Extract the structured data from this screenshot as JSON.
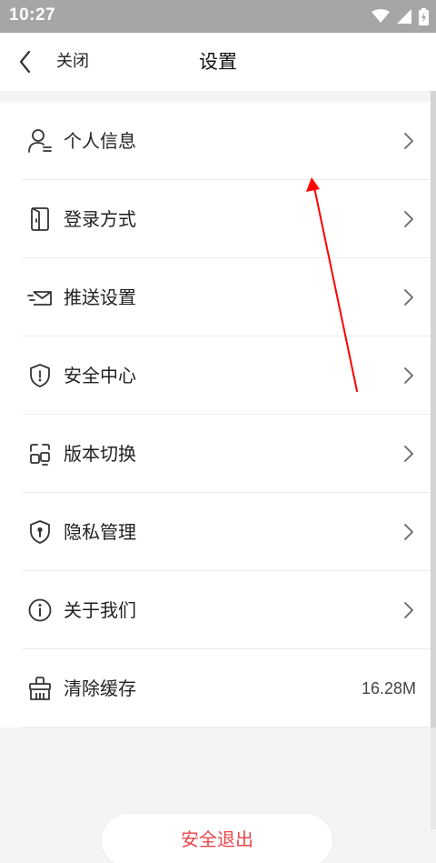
{
  "status_bar": {
    "time": "10:27",
    "icons": [
      "wifi-icon",
      "cellular-signal-icon",
      "battery-charging-icon"
    ]
  },
  "header": {
    "back_icon": "chevron-left-icon",
    "close_label": "关闭",
    "title": "设置"
  },
  "settings": {
    "items": [
      {
        "label": "个人信息",
        "icon": "user-profile-icon",
        "has_chevron": true
      },
      {
        "label": "登录方式",
        "icon": "door-icon",
        "has_chevron": true
      },
      {
        "label": "推送设置",
        "icon": "send-envelope-icon",
        "has_chevron": true
      },
      {
        "label": "安全中心",
        "icon": "shield-icon",
        "has_chevron": true
      },
      {
        "label": "版本切换",
        "icon": "switch-version-icon",
        "has_chevron": true
      },
      {
        "label": "隐私管理",
        "icon": "privacy-shield-icon",
        "has_chevron": true
      },
      {
        "label": "关于我们",
        "icon": "info-icon",
        "has_chevron": true
      },
      {
        "label": "清除缓存",
        "icon": "broom-icon",
        "value": "16.28M"
      }
    ]
  },
  "footer": {
    "logout_label": "安全退出"
  },
  "colors": {
    "status_bar_bg": "#a6a6a6",
    "logout_text": "#e8474a",
    "annotation_arrow": "#ff0000",
    "page_bg": "#f4f4f4"
  }
}
